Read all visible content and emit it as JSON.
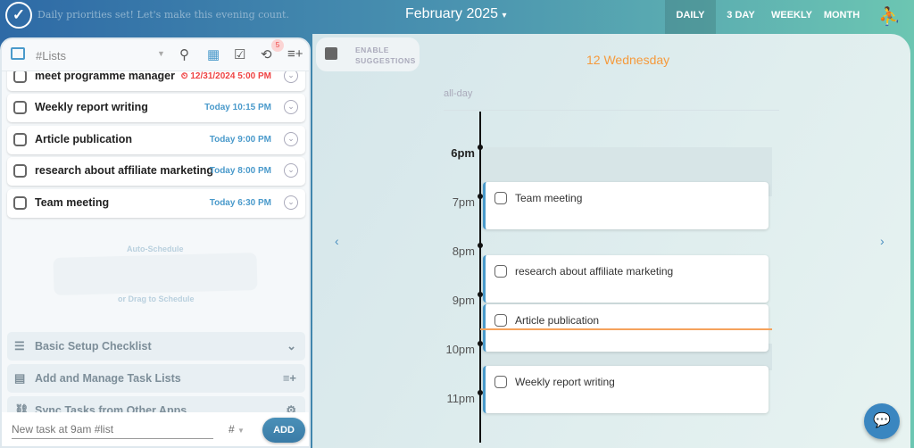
{
  "header": {
    "motd": "Daily priorities set! Let's make this evening count.",
    "month": "February 2025",
    "month_caret": "▾",
    "views": [
      "DAILY",
      "3 DAY",
      "WEEKLY",
      "MONTH"
    ],
    "active_view": "DAILY"
  },
  "toolbar": {
    "list_select": "#Lists",
    "badge": "5"
  },
  "tasks": [
    {
      "name": "meet programme manager",
      "time": "12/31/2024 5:00 PM",
      "overdue": true
    },
    {
      "name": "Weekly report writing",
      "time": "Today 10:15 PM"
    },
    {
      "name": "Article publication",
      "time": "Today 9:00 PM"
    },
    {
      "name": "research about affiliate marketing",
      "time": "Today 8:00 PM"
    },
    {
      "name": "Team meeting",
      "time": "Today 6:30 PM"
    }
  ],
  "hints": {
    "auto": "Auto-Schedule",
    "drag": "or Drag to Schedule"
  },
  "sections": [
    "Basic Setup Checklist",
    "Add and Manage Task Lists",
    "Sync Tasks from Other Apps"
  ],
  "composer": {
    "placeholder": "New task at 9am #list",
    "tag": "#",
    "add": "ADD"
  },
  "suggestions": {
    "line1": "ENABLE",
    "line2": "SUGGESTIONS"
  },
  "calendar": {
    "day": "12 Wednesday",
    "allday": "all-day",
    "hours": [
      "6pm",
      "7pm",
      "8pm",
      "9pm",
      "10pm",
      "11pm"
    ],
    "events": [
      {
        "name": "Team meeting",
        "start": "6:30 PM"
      },
      {
        "name": "research about affiliate marketing",
        "start": "8:00 PM"
      },
      {
        "name": "Article publication",
        "start": "9:00 PM"
      },
      {
        "name": "Weekly report writing",
        "start": "10:15 PM"
      }
    ],
    "current_time": "9:35 PM"
  },
  "colors": {
    "accent": "#4a9acb",
    "today": "#f59a3c",
    "overdue": "#e44444",
    "now_line": "#f5a25c"
  }
}
